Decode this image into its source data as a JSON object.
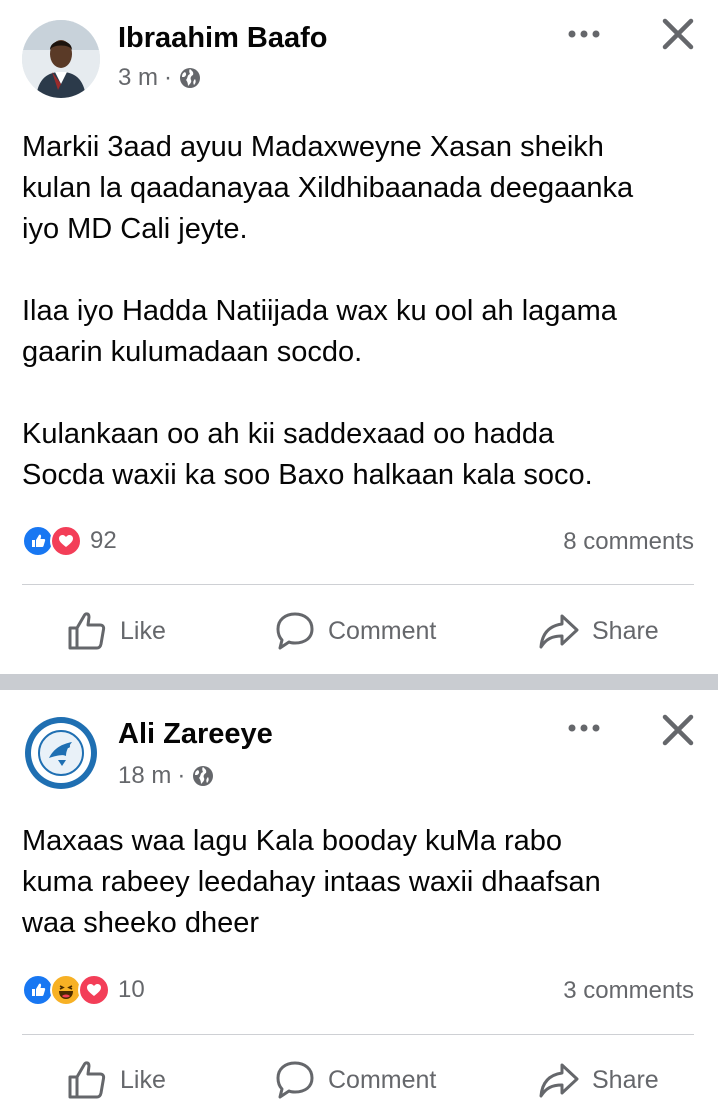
{
  "posts": [
    {
      "author": "Ibraahim Baafo",
      "time": "3 m",
      "dot": "·",
      "body": "Markii 3aad ayuu Madaxweyne Xasan sheikh\nkulan la qaadanayaa Xildhibaanada deegaanka\niyo MD Cali jeyte.\n\nIlaa iyo Hadda Natiijada wax ku ool ah lagama\ngaarin kulumadaan socdo.\n\nKulankaan oo ah kii saddexaad oo hadda\nSocda waxii ka soo Baxo halkaan kala soco.",
      "reaction_icons": [
        "like-icon",
        "love-icon"
      ],
      "reaction_count": "92",
      "comments": "8 comments",
      "actions": {
        "like": "Like",
        "comment": "Comment",
        "share": "Share"
      }
    },
    {
      "author": "Ali Zareeye",
      "time": "18 m",
      "dot": "·",
      "body": "Maxaas waa lagu Kala booday kuMa rabo\nkuma rabeey leedahay intaas waxii dhaafsan\nwaa sheeko dheer",
      "reaction_icons": [
        "like-icon",
        "haha-icon",
        "love-icon"
      ],
      "reaction_count": "10",
      "comments": "3 comments",
      "actions": {
        "like": "Like",
        "comment": "Comment",
        "share": "Share"
      }
    }
  ],
  "colors": {
    "like_blue": "#1877f2",
    "love_red": "#f33e58",
    "haha_yellow": "#f7b125",
    "muted_text": "#65676b",
    "separator": "#c9ccd1"
  }
}
